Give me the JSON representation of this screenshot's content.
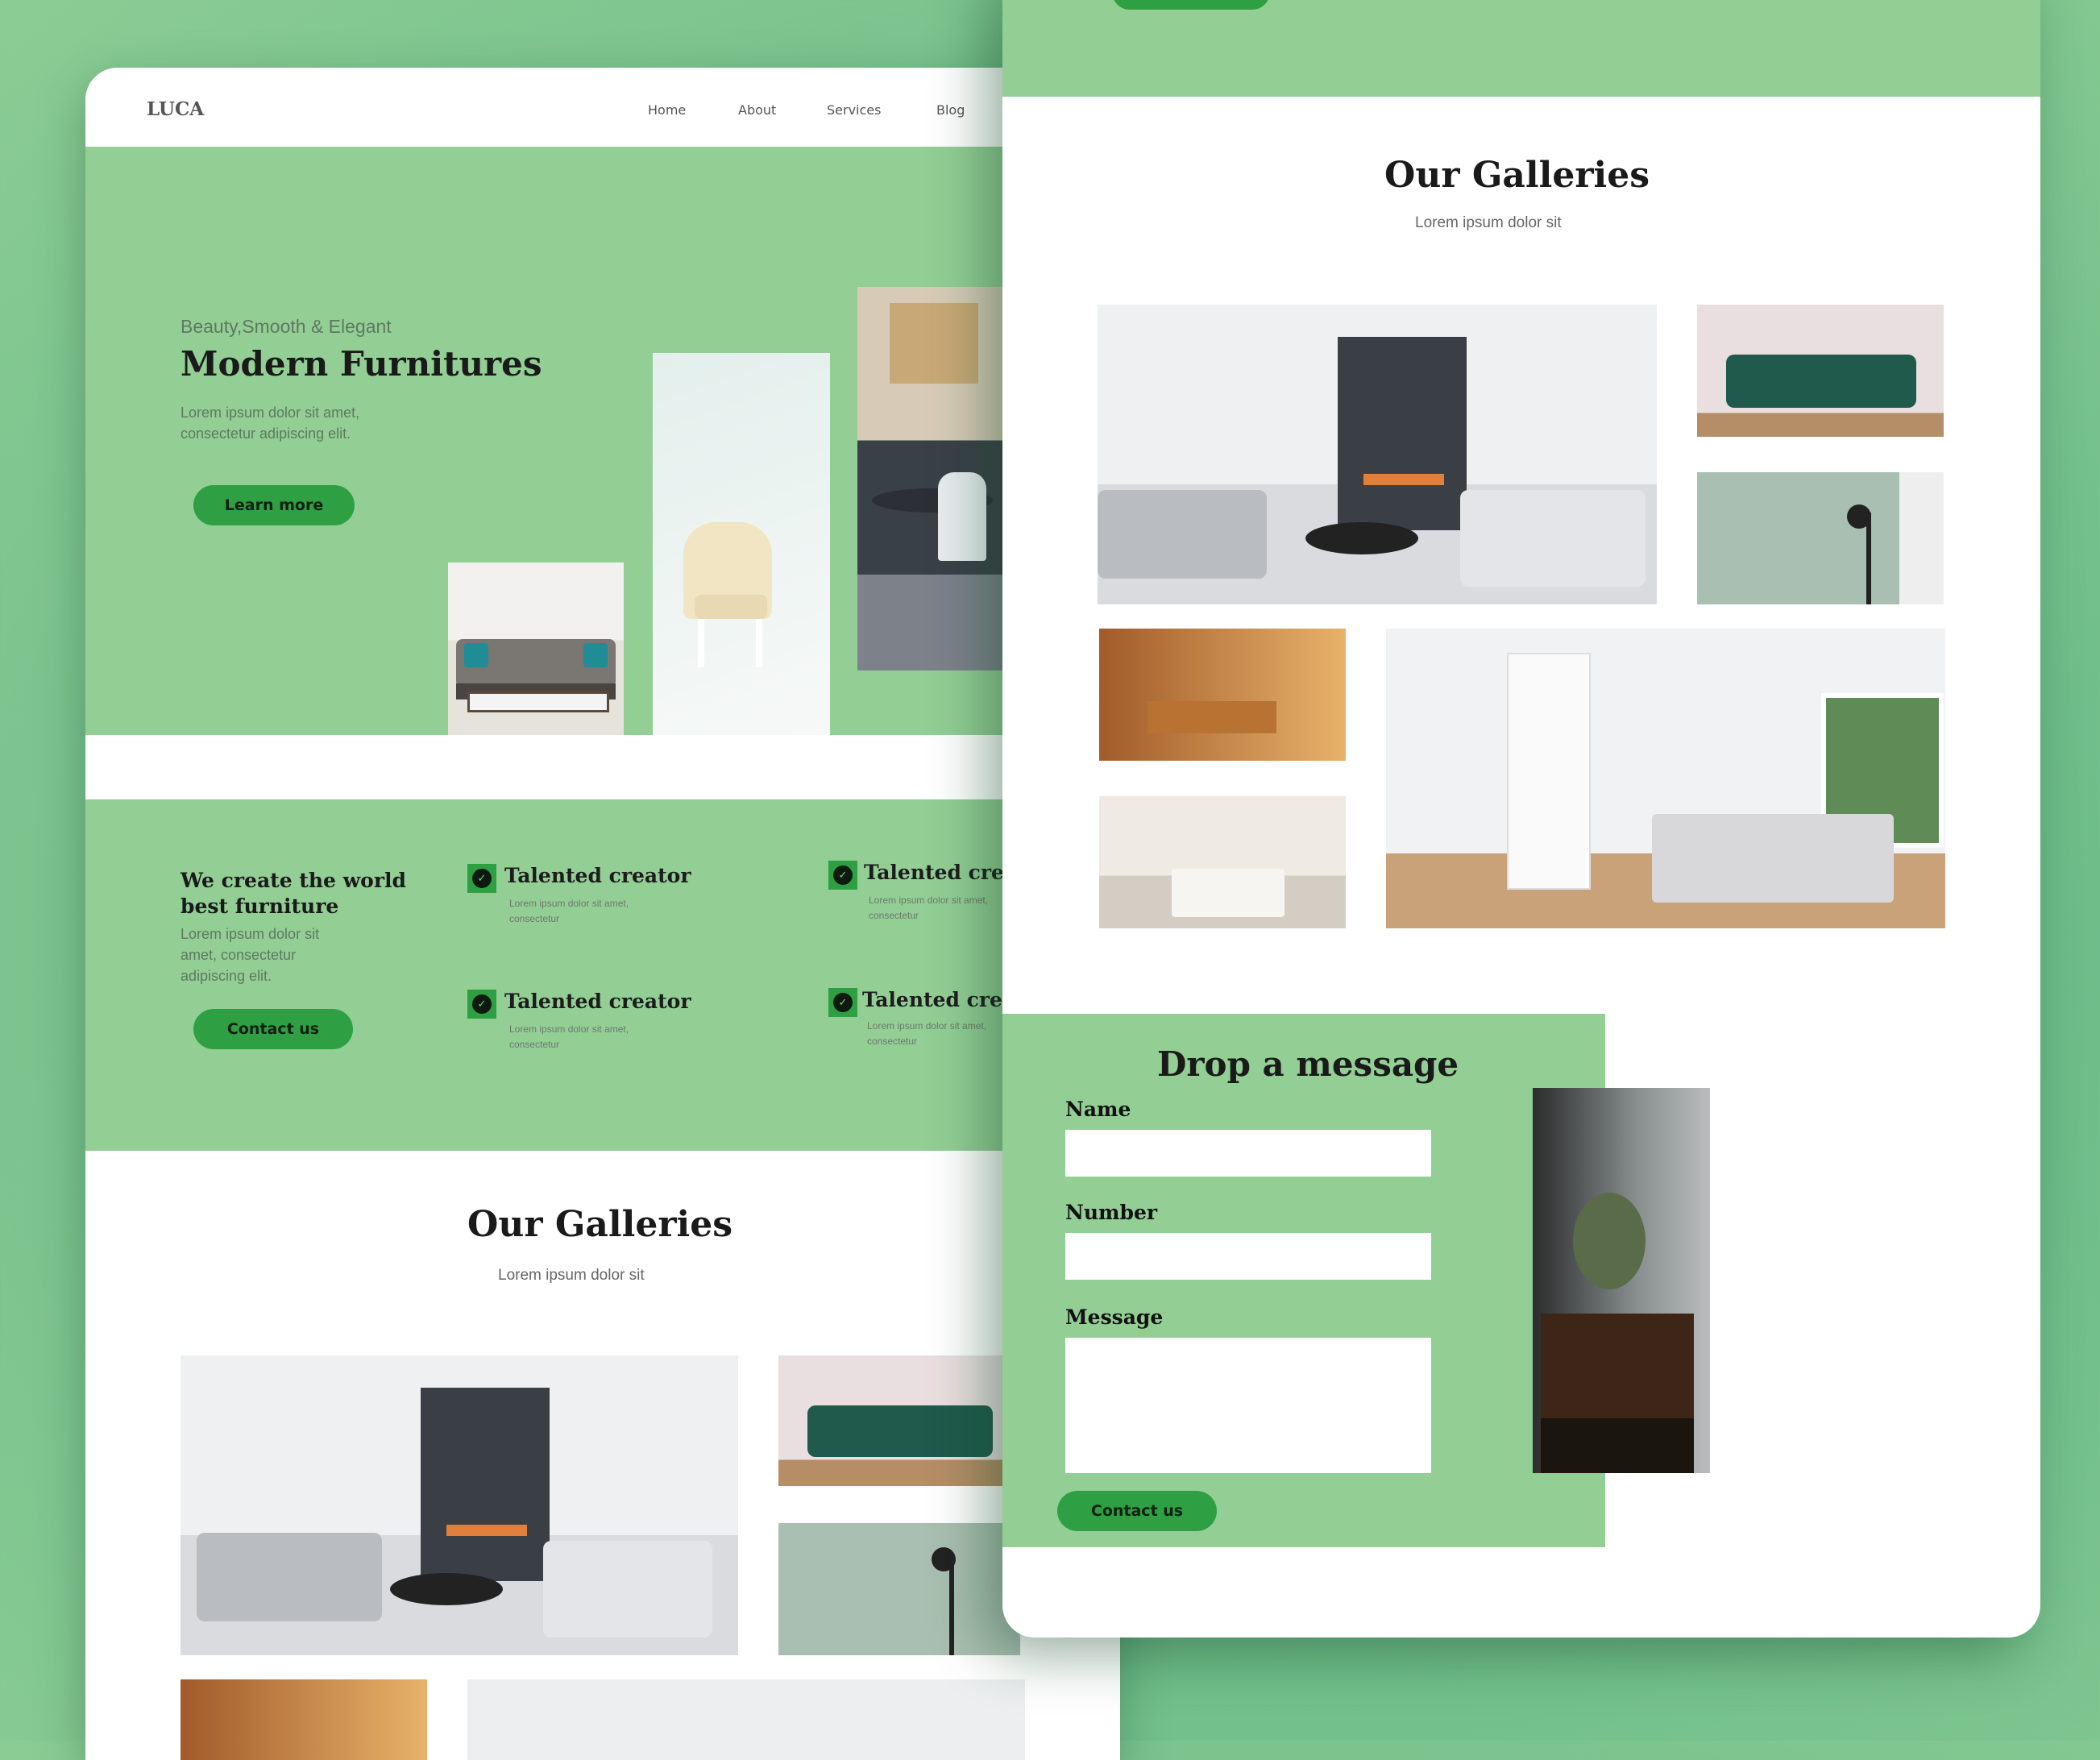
{
  "brand": {
    "logo": "LUCA"
  },
  "nav": {
    "items": [
      "Home",
      "About",
      "Services",
      "Blog"
    ]
  },
  "hero": {
    "eyebrow": "Beauty,Smooth & Elegant",
    "title": "Modern Furnitures",
    "desc_line1": "Lorem ipsum dolor sit amet,",
    "desc_line2": "consectetur adipiscing elit.",
    "cta": "Learn more"
  },
  "features": {
    "heading_line1": "We create the world",
    "heading_line2": "best furniture",
    "desc": "Lorem ipsum dolor sit amet, consectetur adipiscing elit.",
    "cta": "Contact us",
    "items": [
      {
        "title": "Talented creator",
        "desc": "Lorem ipsum dolor sit amet, consectetur"
      },
      {
        "title": "Talented creat",
        "desc": "Lorem ipsum dolor sit amet, consectetur"
      },
      {
        "title": "Talented creator",
        "desc": "Lorem ipsum dolor sit amet, consectetur"
      },
      {
        "title": "Talented creat",
        "desc": "Lorem ipsum dolor sit amet, consectetur"
      }
    ]
  },
  "gallery": {
    "title": "Our Galleries",
    "subtitle": "Lorem ipsum dolor sit"
  },
  "contact": {
    "title": "Drop a message",
    "name_label": "Name",
    "number_label": "Number",
    "message_label": "Message",
    "cta": "Contact us"
  },
  "colors": {
    "green_bg": "#93ce95",
    "button": "#2f9f43",
    "page_bg": "#6dbd8a"
  }
}
